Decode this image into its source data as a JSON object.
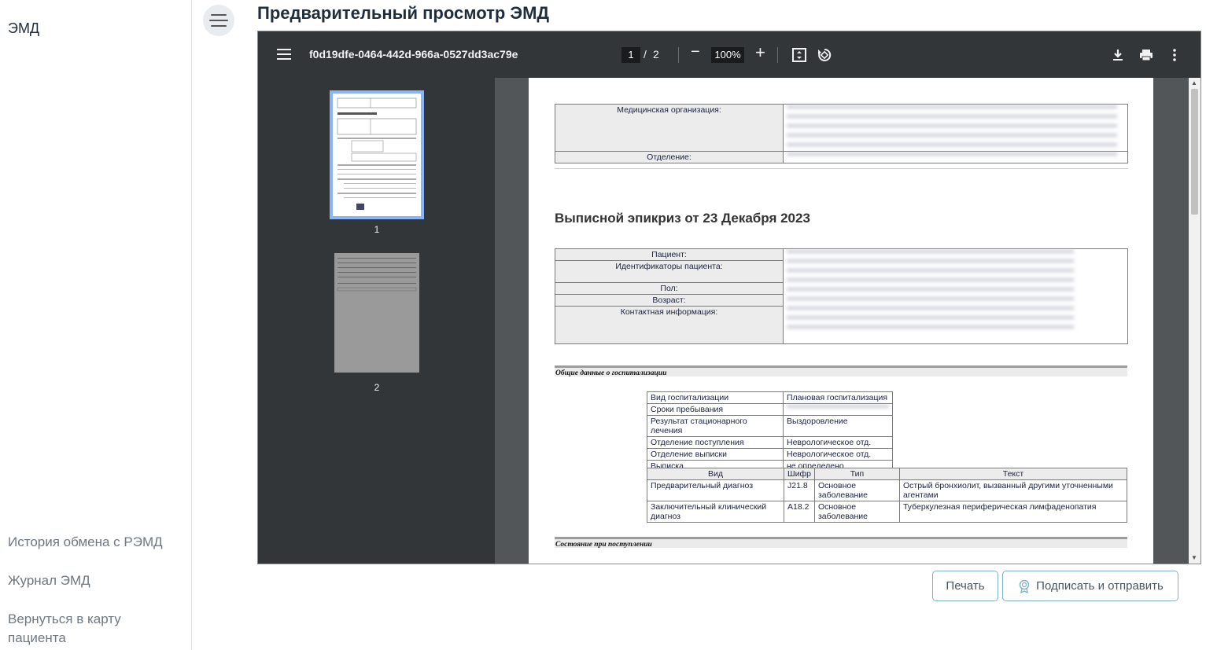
{
  "sidebar": {
    "title": "ЭМД",
    "links": [
      {
        "label": "История обмена с РЭМД"
      },
      {
        "label": "Журнал ЭМД"
      },
      {
        "label": "Вернуться в карту пациента"
      }
    ]
  },
  "header": {
    "title": "Предварительный просмотр ЭМД"
  },
  "viewer": {
    "filename": "f0d19dfe-0464-442d-966a-0527dd3ac79e",
    "current_page": "1",
    "page_separator": "/",
    "total_pages": "2",
    "zoom": "100%",
    "minus": "−",
    "plus": "+",
    "thumbnails": [
      {
        "number": "1"
      },
      {
        "number": "2"
      }
    ]
  },
  "document": {
    "org_label": "Медицинская организация:",
    "dept_label": "Отделение:",
    "heading": "Выписной эпикриз от 23 Декабря 2023",
    "patient": {
      "patient_label": "Пациент:",
      "ids_label": "Идентификаторы пациента:",
      "sex_label": "Пол:",
      "age_label": "Возраст:",
      "contact_label": "Контактная информация:"
    },
    "section_general": "Общие данные о госпитализации",
    "hosp": {
      "type_label": "Вид госпитализации",
      "type_value": "Плановая госпитализация",
      "stay_label": "Сроки пребывания",
      "result_label": "Результат стационарного лечения",
      "result_value": "Выздоровление",
      "admit_label": "Отделение поступления",
      "admit_value": "Неврологическое отд.",
      "discharge_label": "Отделение выписки",
      "discharge_value": "Неврологическое отд.",
      "discharge_type_label": "Выписка",
      "discharge_type_value": "не определено"
    },
    "diag": {
      "headers": {
        "kind": "Вид",
        "code": "Шифр",
        "type": "Тип",
        "text": "Текст"
      },
      "rows": [
        {
          "kind": "Предварительный диагноз",
          "code": "J21.8",
          "type": "Основное заболевание",
          "text": "Острый бронхиолит, вызванный другими уточненными агентами"
        },
        {
          "kind": "Заключительный клинический диагноз",
          "code": "A18.2",
          "type": "Основное заболевание",
          "text": "Туберкулезная периферическая лимфаденопатия"
        }
      ]
    },
    "section_admission": "Состояние при поступлении"
  },
  "buttons": {
    "print": "Печать",
    "sign_send": "Подписать и отправить"
  }
}
